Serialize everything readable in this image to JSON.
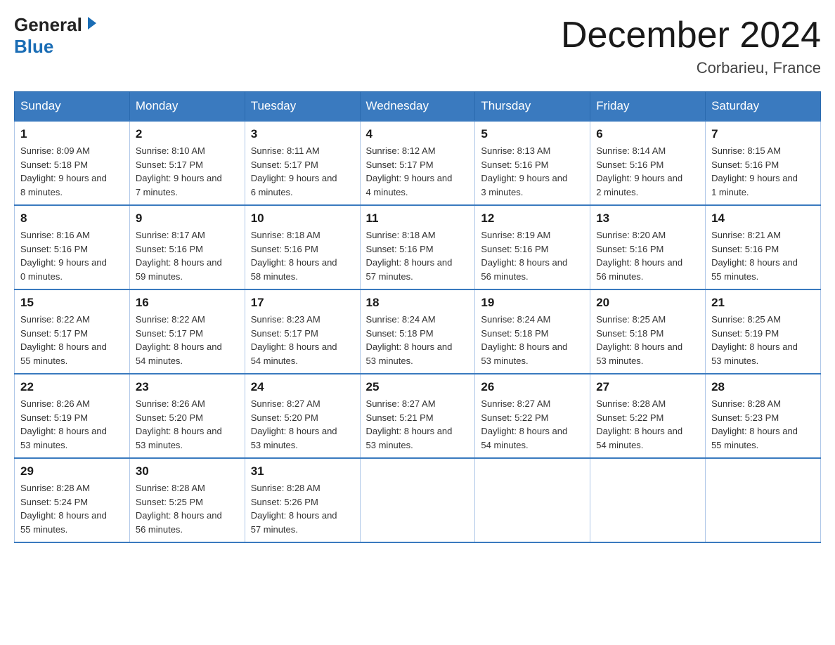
{
  "header": {
    "logo_general": "General",
    "logo_blue": "Blue",
    "month_year": "December 2024",
    "location": "Corbarieu, France"
  },
  "calendar": {
    "days_of_week": [
      "Sunday",
      "Monday",
      "Tuesday",
      "Wednesday",
      "Thursday",
      "Friday",
      "Saturday"
    ],
    "weeks": [
      [
        {
          "day": "1",
          "sunrise": "8:09 AM",
          "sunset": "5:18 PM",
          "daylight": "9 hours and 8 minutes."
        },
        {
          "day": "2",
          "sunrise": "8:10 AM",
          "sunset": "5:17 PM",
          "daylight": "9 hours and 7 minutes."
        },
        {
          "day": "3",
          "sunrise": "8:11 AM",
          "sunset": "5:17 PM",
          "daylight": "9 hours and 6 minutes."
        },
        {
          "day": "4",
          "sunrise": "8:12 AM",
          "sunset": "5:17 PM",
          "daylight": "9 hours and 4 minutes."
        },
        {
          "day": "5",
          "sunrise": "8:13 AM",
          "sunset": "5:16 PM",
          "daylight": "9 hours and 3 minutes."
        },
        {
          "day": "6",
          "sunrise": "8:14 AM",
          "sunset": "5:16 PM",
          "daylight": "9 hours and 2 minutes."
        },
        {
          "day": "7",
          "sunrise": "8:15 AM",
          "sunset": "5:16 PM",
          "daylight": "9 hours and 1 minute."
        }
      ],
      [
        {
          "day": "8",
          "sunrise": "8:16 AM",
          "sunset": "5:16 PM",
          "daylight": "9 hours and 0 minutes."
        },
        {
          "day": "9",
          "sunrise": "8:17 AM",
          "sunset": "5:16 PM",
          "daylight": "8 hours and 59 minutes."
        },
        {
          "day": "10",
          "sunrise": "8:18 AM",
          "sunset": "5:16 PM",
          "daylight": "8 hours and 58 minutes."
        },
        {
          "day": "11",
          "sunrise": "8:18 AM",
          "sunset": "5:16 PM",
          "daylight": "8 hours and 57 minutes."
        },
        {
          "day": "12",
          "sunrise": "8:19 AM",
          "sunset": "5:16 PM",
          "daylight": "8 hours and 56 minutes."
        },
        {
          "day": "13",
          "sunrise": "8:20 AM",
          "sunset": "5:16 PM",
          "daylight": "8 hours and 56 minutes."
        },
        {
          "day": "14",
          "sunrise": "8:21 AM",
          "sunset": "5:16 PM",
          "daylight": "8 hours and 55 minutes."
        }
      ],
      [
        {
          "day": "15",
          "sunrise": "8:22 AM",
          "sunset": "5:17 PM",
          "daylight": "8 hours and 55 minutes."
        },
        {
          "day": "16",
          "sunrise": "8:22 AM",
          "sunset": "5:17 PM",
          "daylight": "8 hours and 54 minutes."
        },
        {
          "day": "17",
          "sunrise": "8:23 AM",
          "sunset": "5:17 PM",
          "daylight": "8 hours and 54 minutes."
        },
        {
          "day": "18",
          "sunrise": "8:24 AM",
          "sunset": "5:18 PM",
          "daylight": "8 hours and 53 minutes."
        },
        {
          "day": "19",
          "sunrise": "8:24 AM",
          "sunset": "5:18 PM",
          "daylight": "8 hours and 53 minutes."
        },
        {
          "day": "20",
          "sunrise": "8:25 AM",
          "sunset": "5:18 PM",
          "daylight": "8 hours and 53 minutes."
        },
        {
          "day": "21",
          "sunrise": "8:25 AM",
          "sunset": "5:19 PM",
          "daylight": "8 hours and 53 minutes."
        }
      ],
      [
        {
          "day": "22",
          "sunrise": "8:26 AM",
          "sunset": "5:19 PM",
          "daylight": "8 hours and 53 minutes."
        },
        {
          "day": "23",
          "sunrise": "8:26 AM",
          "sunset": "5:20 PM",
          "daylight": "8 hours and 53 minutes."
        },
        {
          "day": "24",
          "sunrise": "8:27 AM",
          "sunset": "5:20 PM",
          "daylight": "8 hours and 53 minutes."
        },
        {
          "day": "25",
          "sunrise": "8:27 AM",
          "sunset": "5:21 PM",
          "daylight": "8 hours and 53 minutes."
        },
        {
          "day": "26",
          "sunrise": "8:27 AM",
          "sunset": "5:22 PM",
          "daylight": "8 hours and 54 minutes."
        },
        {
          "day": "27",
          "sunrise": "8:28 AM",
          "sunset": "5:22 PM",
          "daylight": "8 hours and 54 minutes."
        },
        {
          "day": "28",
          "sunrise": "8:28 AM",
          "sunset": "5:23 PM",
          "daylight": "8 hours and 55 minutes."
        }
      ],
      [
        {
          "day": "29",
          "sunrise": "8:28 AM",
          "sunset": "5:24 PM",
          "daylight": "8 hours and 55 minutes."
        },
        {
          "day": "30",
          "sunrise": "8:28 AM",
          "sunset": "5:25 PM",
          "daylight": "8 hours and 56 minutes."
        },
        {
          "day": "31",
          "sunrise": "8:28 AM",
          "sunset": "5:26 PM",
          "daylight": "8 hours and 57 minutes."
        },
        null,
        null,
        null,
        null
      ]
    ],
    "labels": {
      "sunrise": "Sunrise:",
      "sunset": "Sunset:",
      "daylight": "Daylight:"
    }
  }
}
